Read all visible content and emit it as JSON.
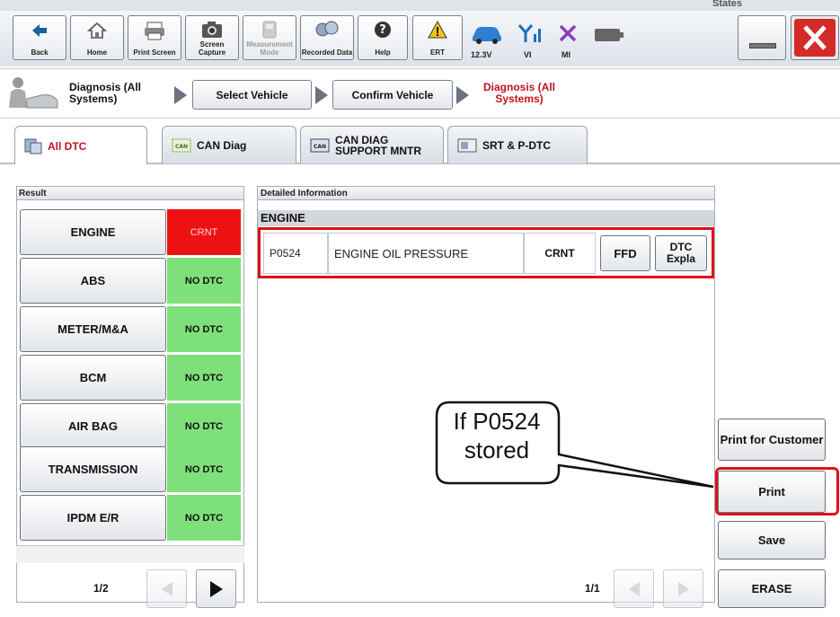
{
  "window": {
    "title_fragment": "States",
    "maximize_icon": "maximize-icon",
    "close_icon": "close-icon"
  },
  "toolbar": {
    "back": "Back",
    "home": "Home",
    "print_screen": "Print Screen",
    "screen_capture": "Screen Capture",
    "measurement_mode": "Measurement Mode",
    "recorded_data": "Recorded Data",
    "help": "Help",
    "ert": "ERT",
    "voltage": "12.3V",
    "vi": "VI",
    "mi": "MI"
  },
  "breadcrumb": {
    "current_section": "Diagnosis (All Systems)",
    "step1": "Select Vehicle",
    "step2": "Confirm Vehicle",
    "step3": "Diagnosis (All Systems)"
  },
  "tabs": [
    {
      "label": "All DTC"
    },
    {
      "label": "CAN Diag"
    },
    {
      "label": "CAN DIAG SUPPORT MNTR"
    },
    {
      "label": "SRT & P-DTC"
    }
  ],
  "result_panel": {
    "header": "Result",
    "systems": [
      {
        "name": "ENGINE",
        "status": "CRNT"
      },
      {
        "name": "ABS",
        "status": "NO DTC"
      },
      {
        "name": "METER/M&A",
        "status": "NO DTC"
      },
      {
        "name": "BCM",
        "status": "NO DTC"
      },
      {
        "name": "AIR BAG",
        "status": "NO DTC"
      },
      {
        "name": "TRANSMISSION",
        "status": "NO DTC"
      },
      {
        "name": "IPDM E/R",
        "status": "NO DTC"
      }
    ],
    "page": "1/2"
  },
  "detail_panel": {
    "header": "Detailed Information",
    "system": "ENGINE",
    "dtc_code": "P0524",
    "dtc_desc": "ENGINE OIL PRESSURE",
    "dtc_status": "CRNT",
    "ffd": "FFD",
    "dtc_expla": "DTC Expla",
    "page": "1/1"
  },
  "side_buttons": {
    "print_customer": "Print for Customer",
    "print": "Print",
    "save": "Save",
    "erase": "ERASE"
  },
  "callout": {
    "text": "If P0524 stored"
  },
  "colors": {
    "crnt_red": "#ee1111",
    "nodtc_green": "#7ee07a",
    "highlight_red": "#e0101a"
  }
}
